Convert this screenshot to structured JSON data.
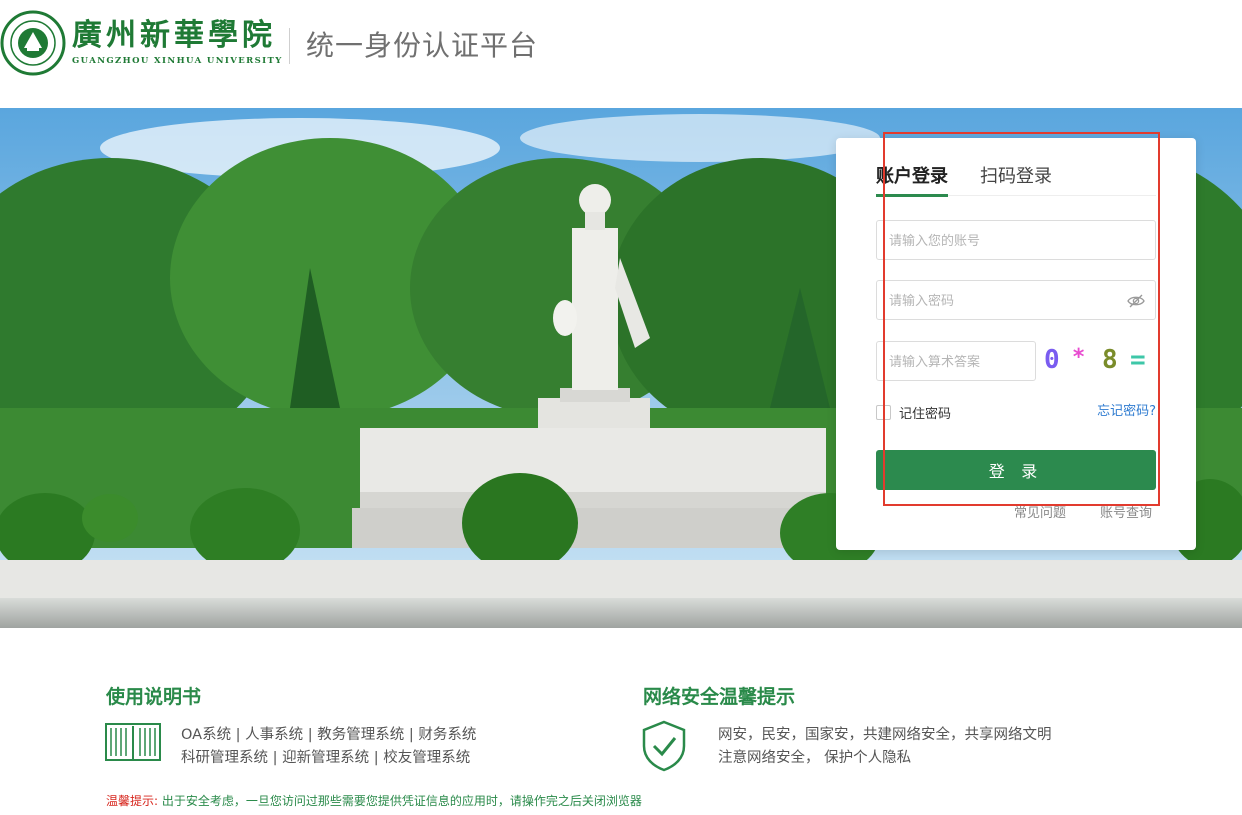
{
  "header": {
    "school_name": "廣州新華學院",
    "school_name_en": "GUANGZHOU XINHUA UNIVERSITY",
    "platform_title": "统一身份认证平台"
  },
  "login": {
    "tabs": [
      {
        "label": "账户登录",
        "active": true
      },
      {
        "label": "扫码登录",
        "active": false
      }
    ],
    "account_placeholder": "请输入您的账号",
    "password_placeholder": "请输入密码",
    "captcha_placeholder": "请输入算术答案",
    "captcha": [
      "0",
      "*",
      "8",
      "="
    ],
    "remember_label": "记住密码",
    "forgot_label": "忘记密码?",
    "login_button": "登 录",
    "faq_label": "常见问题",
    "account_query_label": "账号查询"
  },
  "footer": {
    "guide_title": "使用说明书",
    "guide_lines": [
      "OA系统  |  人事系统 | 教务管理系统  |  财务系统",
      "科研管理系统 | 迎新管理系统 | 校友管理系统"
    ],
    "safety_title": "网络安全温馨提示",
    "safety_lines": [
      "网安，民安，国家安，共建网络安全，共享网络文明",
      "注意网络安全， 保护个人隐私"
    ],
    "tip_label": "温馨提示:",
    "tip_text": " 出于安全考虑，一旦您访问过那些需要您提供凭证信息的应用时，请操作完之后关闭浏览器"
  },
  "colors": {
    "brand_green": "#2c8a4e",
    "highlight_red": "#e23b2e",
    "link_blue": "#2e7bd0"
  },
  "icons": [
    "university-seal-icon",
    "eye-off-icon",
    "book-icon",
    "shield-check-icon"
  ]
}
